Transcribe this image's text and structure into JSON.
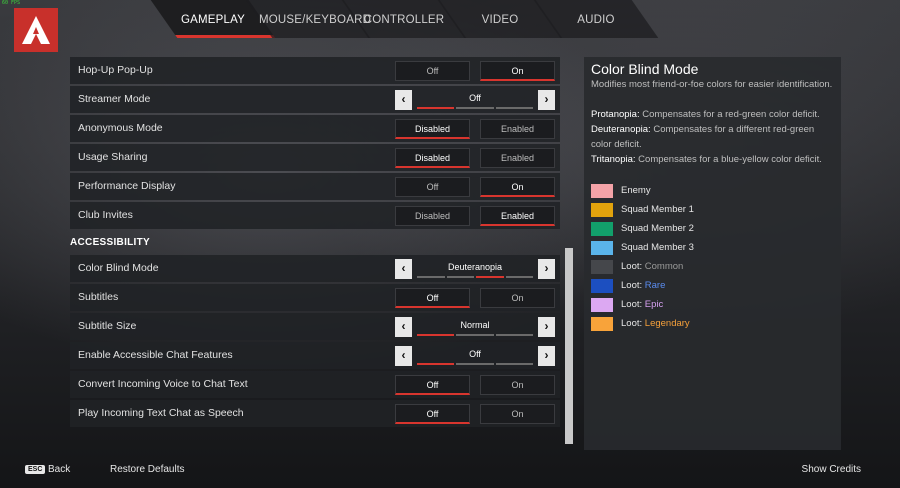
{
  "fps_text": "60 FPS",
  "tabs": [
    {
      "label": "GAMEPLAY",
      "active": true
    },
    {
      "label": "MOUSE/KEYBOARD",
      "active": false
    },
    {
      "label": "CONTROLLER",
      "active": false
    },
    {
      "label": "VIDEO",
      "active": false
    },
    {
      "label": "AUDIO",
      "active": false
    }
  ],
  "rows": {
    "hopup": {
      "label": "Hop-Up Pop-Up",
      "opt1": "Off",
      "opt2": "On"
    },
    "streamer": {
      "label": "Streamer Mode",
      "value": "Off"
    },
    "anonymous": {
      "label": "Anonymous Mode",
      "opt1": "Disabled",
      "opt2": "Enabled"
    },
    "usage": {
      "label": "Usage Sharing",
      "opt1": "Disabled",
      "opt2": "Enabled"
    },
    "perf": {
      "label": "Performance Display",
      "opt1": "Off",
      "opt2": "On"
    },
    "club": {
      "label": "Club Invites",
      "opt1": "Disabled",
      "opt2": "Enabled"
    }
  },
  "accessibility": {
    "heading": "ACCESSIBILITY",
    "colorblind": {
      "label": "Color Blind Mode",
      "value": "Deuteranopia"
    },
    "subtitles": {
      "label": "Subtitles",
      "opt1": "Off",
      "opt2": "On"
    },
    "subtitle_size": {
      "label": "Subtitle Size",
      "value": "Normal"
    },
    "chat_features": {
      "label": "Enable Accessible Chat Features",
      "value": "Off"
    },
    "voice_to_text": {
      "label": "Convert Incoming Voice to Chat Text",
      "opt1": "Off",
      "opt2": "On"
    },
    "text_to_speech": {
      "label": "Play Incoming Text Chat as Speech",
      "opt1": "Off",
      "opt2": "On"
    }
  },
  "info": {
    "title": "Color Blind Mode",
    "desc": "Modifies most friend-or-foe colors for easier identification.",
    "protanopia_term": "Protanopia:",
    "protanopia_text": "Compensates for a red-green color deficit.",
    "deuteranopia_term": "Deuteranopia:",
    "deuteranopia_text": "Compensates for a different red-green color deficit.",
    "tritanopia_term": "Tritanopia:",
    "tritanopia_text": "Compensates for a blue-yellow color deficit.",
    "legend": [
      {
        "label": "Enemy",
        "suffix": "",
        "color": "#f4a3a8",
        "suffix_color": ""
      },
      {
        "label": "Squad Member 1",
        "suffix": "",
        "color": "#e2a30d",
        "suffix_color": ""
      },
      {
        "label": "Squad Member 2",
        "suffix": "",
        "color": "#12a06b",
        "suffix_color": ""
      },
      {
        "label": "Squad Member 3",
        "suffix": "",
        "color": "#5ab4ea",
        "suffix_color": ""
      },
      {
        "label": "Loot:",
        "suffix": "Common",
        "color": "#45474b",
        "suffix_color": "#9a9a9a"
      },
      {
        "label": "Loot:",
        "suffix": "Rare",
        "color": "#1c4fc0",
        "suffix_color": "#5a8cf0"
      },
      {
        "label": "Loot:",
        "suffix": "Epic",
        "color": "#dca8f2",
        "suffix_color": "#d6a0f0"
      },
      {
        "label": "Loot:",
        "suffix": "Legendary",
        "color": "#f8a33a",
        "suffix_color": "#f5a03a"
      }
    ]
  },
  "footer": {
    "esc_key": "ESC",
    "back": "Back",
    "restore": "Restore Defaults",
    "credits": "Show Credits"
  },
  "colors": {
    "accent": "#d8352e",
    "logo_bg": "#c8302b"
  }
}
